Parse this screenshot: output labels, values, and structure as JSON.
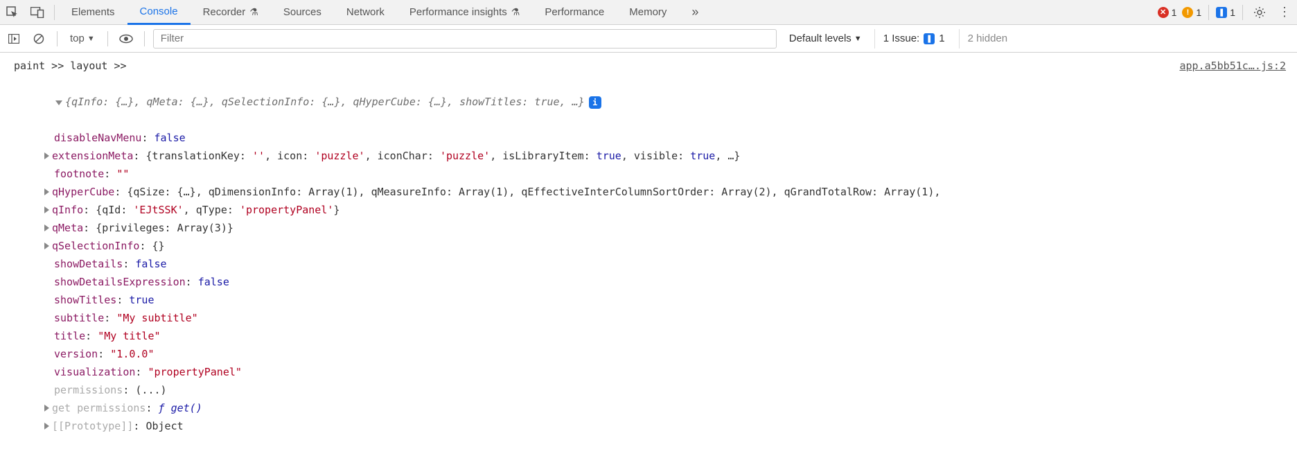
{
  "tabs": {
    "elements": "Elements",
    "console": "Console",
    "recorder": "Recorder",
    "sources": "Sources",
    "network": "Network",
    "perfinsights": "Performance insights",
    "performance": "Performance",
    "memory": "Memory"
  },
  "status": {
    "errors": "1",
    "warnings": "1",
    "messages": "1"
  },
  "toolbar": {
    "context": "top",
    "filter_placeholder": "Filter",
    "levels": "Default levels",
    "issue_label": "1 Issue:",
    "issue_count": "1",
    "hidden": "2 hidden"
  },
  "log": {
    "pre": "paint >> layout >>",
    "source": "app.a5bb51c….js:2",
    "summary": "{qInfo: {…}, qMeta: {…}, qSelectionInfo: {…}, qHyperCube: {…}, showTitles: true, …}",
    "disableNavMenu": {
      "key": "disableNavMenu",
      "val": "false"
    },
    "extensionMeta": {
      "key": "extensionMeta",
      "val": "{translationKey: '', icon: 'puzzle', iconChar: 'puzzle', isLibraryItem: true, visible: true, …}"
    },
    "footnote": {
      "key": "footnote",
      "val": "\"\""
    },
    "qHyperCube": {
      "key": "qHyperCube",
      "val": "{qSize: {…}, qDimensionInfo: Array(1), qMeasureInfo: Array(1), qEffectiveInterColumnSortOrder: Array(2), qGrandTotalRow: Array(1),"
    },
    "qInfo": {
      "key": "qInfo",
      "val": "{qId: 'EJtSSK', qType: 'propertyPanel'}"
    },
    "qMeta": {
      "key": "qMeta",
      "val": "{privileges: Array(3)}"
    },
    "qSelectionInfo": {
      "key": "qSelectionInfo",
      "val": "{}"
    },
    "showDetails": {
      "key": "showDetails",
      "val": "false"
    },
    "showDetailsExpression": {
      "key": "showDetailsExpression",
      "val": "false"
    },
    "showTitles": {
      "key": "showTitles",
      "val": "true"
    },
    "subtitle": {
      "key": "subtitle",
      "val": "\"My subtitle\""
    },
    "title": {
      "key": "title",
      "val": "\"My title\""
    },
    "version": {
      "key": "version",
      "val": "\"1.0.0\""
    },
    "visualization": {
      "key": "visualization",
      "val": "\"propertyPanel\""
    },
    "permissions": {
      "key": "permissions",
      "val": "(...)"
    },
    "getPermissions": {
      "key": "get permissions",
      "val": "ƒ get()"
    },
    "prototype": {
      "key": "[[Prototype]]",
      "val": "Object"
    }
  }
}
